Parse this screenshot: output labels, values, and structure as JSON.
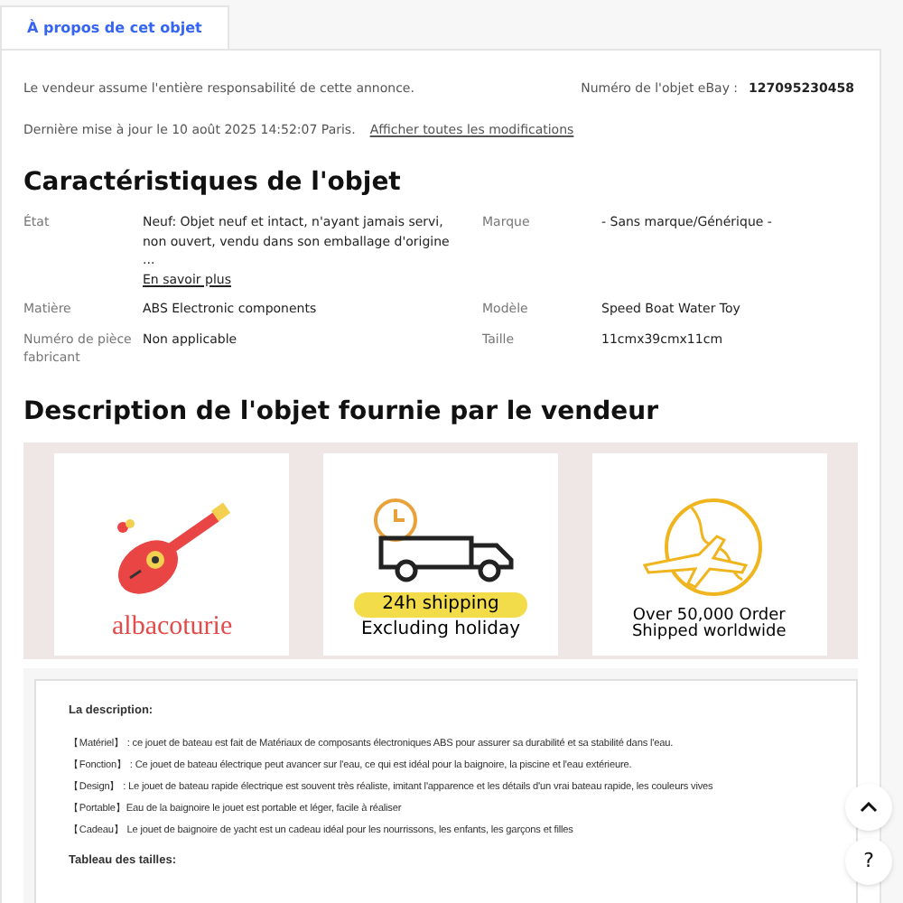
{
  "tabs": [
    {
      "label": "À propos de cet objet",
      "selected": true
    }
  ],
  "notice": "Le vendeur assume l'entière responsabilité de cette annonce.",
  "item_number": {
    "label": "Numéro de l'objet eBay :",
    "value": "127095230458"
  },
  "last_update": {
    "text": "Dernière mise à jour le 10 août 2025 14:52:07 Paris.",
    "link": "Afficher toutes les modifications"
  },
  "specifics": {
    "title": "Caractéristiques de l'objet",
    "rows": [
      [
        {
          "label": "État",
          "value": "Neuf: Objet neuf et intact, n'ayant jamais servi, non ouvert, vendu dans son emballage d'origine ...",
          "link": "En savoir plus"
        },
        {
          "label": "Marque",
          "value": "- Sans marque/Générique -"
        }
      ],
      [
        {
          "label": "Matière",
          "value": "ABS Electronic components"
        },
        {
          "label": "Modèle",
          "value": "Speed Boat Water Toy"
        }
      ],
      [
        {
          "label": "Numéro de pièce fabricant",
          "value": "Non applicable"
        },
        {
          "label": "Taille",
          "value": "11cmx39cmx11cm"
        }
      ]
    ]
  },
  "description": {
    "title": "Description de l'objet fournie par le vendeur",
    "banners": [
      {
        "kind": "guitar",
        "lines": [
          "albacoturie"
        ]
      },
      {
        "kind": "truck",
        "lines": [
          "24h shipping",
          "Excluding holiday"
        ]
      },
      {
        "kind": "globe",
        "lines": [
          "Over 50,000 Order",
          "Shipped worldwide"
        ]
      }
    ],
    "heading": "La description:",
    "items": [
      {
        "tag": "【Matériel】",
        "text": " : ce jouet de bateau est fait de Matériaux de composants électroniques ABS pour assurer sa durabilité et sa stabilité dans l'eau."
      },
      {
        "tag": "【Fonction】",
        "text": " : Ce jouet de bateau électrique peut avancer sur l'eau, ce qui est idéal pour la baignoire, la piscine et l'eau extérieure."
      },
      {
        "tag": "【Design】",
        "text": " : Le jouet de bateau rapide électrique est souvent très réaliste, imitant l'apparence et les détails d'un vrai bateau rapide, les couleurs vives"
      },
      {
        "tag": "【Portable】",
        "text": "Eau de la baignoire le jouet est portable et léger, facile à réaliser"
      },
      {
        "tag": "【Cadeau】",
        "text": " Le jouet de baignoire de yacht est un cadeau idéal pour les nourrissons, les enfants, les garçons et filles"
      }
    ],
    "size_heading": "Tableau des tailles:"
  },
  "help_button": "?"
}
